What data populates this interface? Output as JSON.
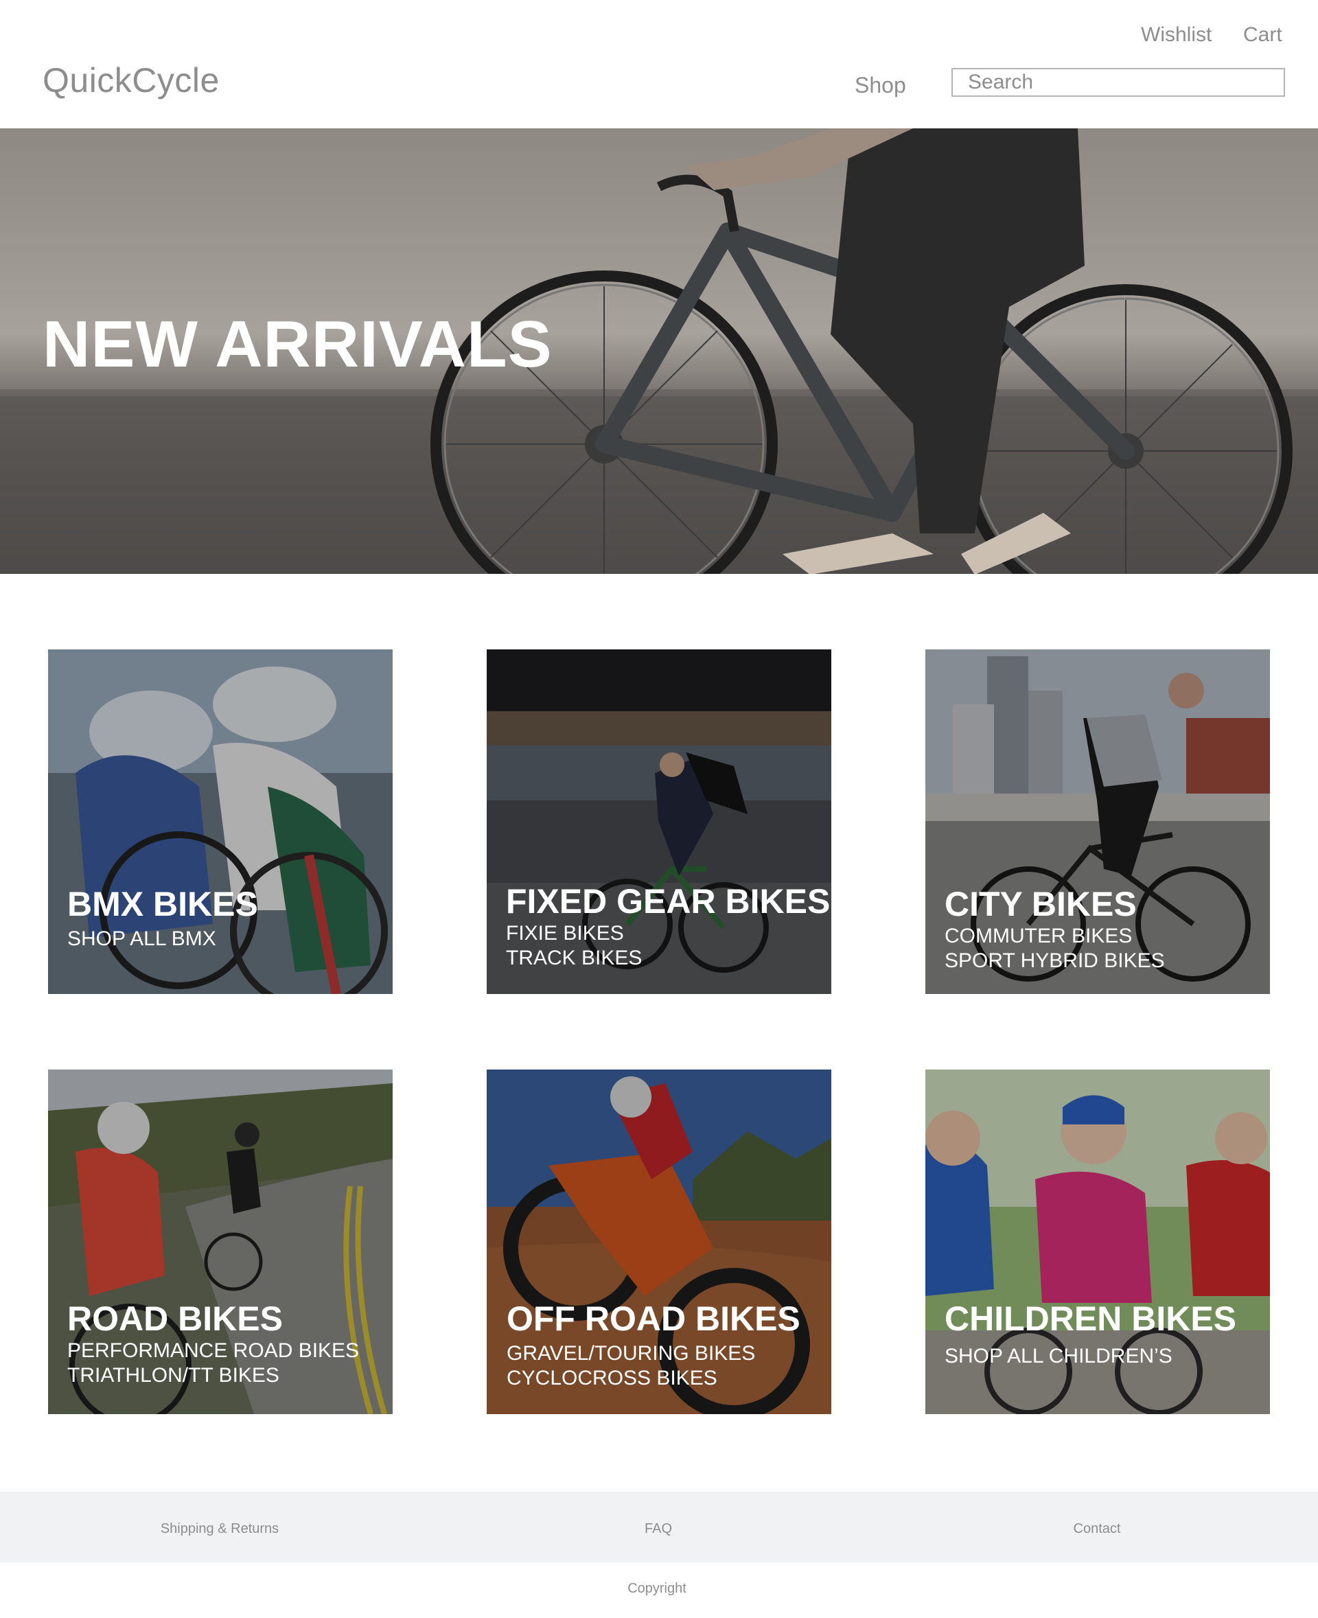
{
  "header": {
    "logo": "QuickCycle",
    "wishlist_label": "Wishlist",
    "cart_label": "Cart",
    "shop_label": "Shop",
    "search_placeholder": "Search"
  },
  "hero": {
    "title": "NEW ARRIVALS"
  },
  "categories": [
    {
      "title": "BMX BIKES",
      "links": [
        "SHOP ALL BMX"
      ]
    },
    {
      "title": "FIXED GEAR BIKES",
      "links": [
        "FIXIE BIKES",
        "TRACK BIKES"
      ]
    },
    {
      "title": "CITY BIKES",
      "links": [
        "COMMUTER BIKES",
        "SPORT HYBRID BIKES"
      ]
    },
    {
      "title": "ROAD BIKES",
      "links": [
        "PERFORMANCE ROAD BIKES",
        "TRIATHLON/TT BIKES"
      ]
    },
    {
      "title": "OFF ROAD BIKES",
      "links": [
        "GRAVEL/TOURING BIKES",
        "CYCLOCROSS BIKES"
      ]
    },
    {
      "title": "CHILDREN BIKES",
      "links": [
        "SHOP ALL CHILDREN’S"
      ]
    }
  ],
  "footer": {
    "links": [
      "Shipping & Returns",
      "FAQ",
      "Contact"
    ],
    "copyright": "Copyright"
  },
  "colors": {
    "text_gray": "#8d8d8d",
    "footer_bg": "#f1f2f4",
    "overlay_text": "#ffffff"
  }
}
